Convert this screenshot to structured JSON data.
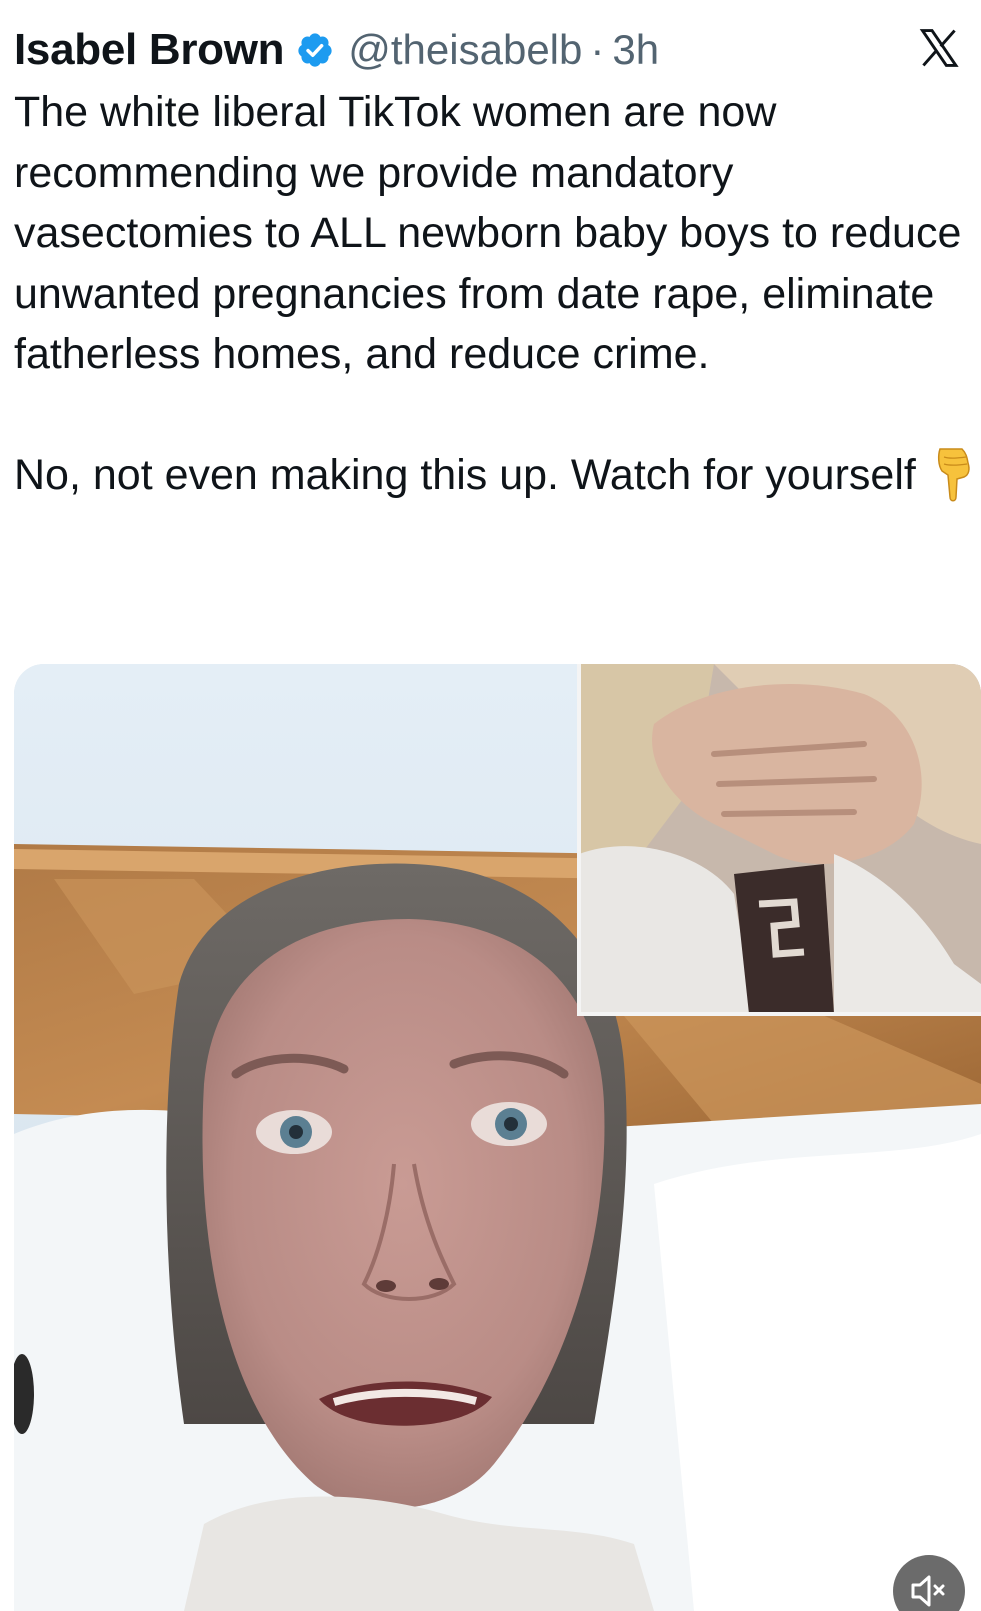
{
  "tweet": {
    "display_name": "Isabel Brown",
    "handle": "@theisabelb",
    "separator": "·",
    "time": "3h",
    "text_paragraph_1": "The white liberal TikTok women are now recommending we provide mandatory vasectomies to ALL newborn baby boys to reduce unwanted pregnancies from date rape, eliminate fatherless homes, and reduce crime.",
    "text_paragraph_2": "No, not even making this up. Watch for yourself"
  },
  "icons": {
    "verified": "verified-badge-icon",
    "platform": "x-logo-icon",
    "emoji": "backhand-index-pointing-down-icon",
    "mute": "speaker-muted-icon"
  },
  "colors": {
    "verified_blue": "#1d9bf0",
    "text": "#0f1419",
    "secondary_text": "#536471"
  }
}
